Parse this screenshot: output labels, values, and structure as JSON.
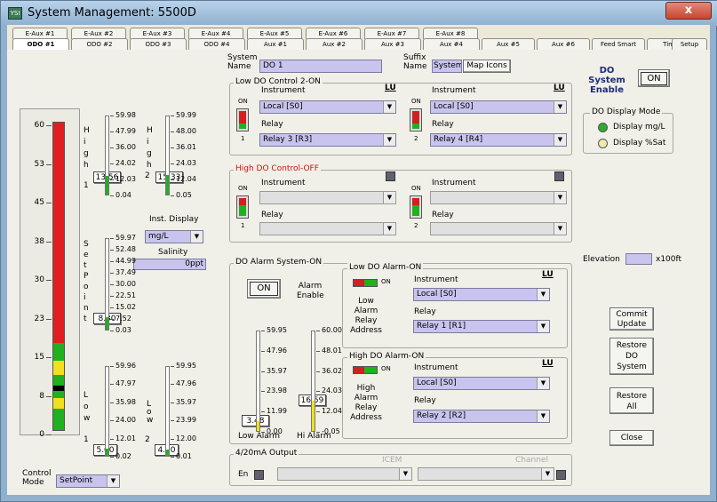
{
  "window": {
    "title": "System Management: 5500D",
    "icon": "app-icon",
    "close": "x"
  },
  "tabs_top": [
    "E-Aux #1",
    "E-Aux #2",
    "E-Aux #3",
    "E-Aux #4",
    "E-Aux #5",
    "E-Aux #6",
    "E-Aux #7",
    "E-Aux #8"
  ],
  "tabs_bottom": [
    "ODO #1",
    "ODO #2",
    "ODO #3",
    "ODO #4",
    "Aux #1",
    "Aux #2",
    "Aux #3",
    "Aux #4",
    "Aux #5",
    "Aux #6",
    "Feed Smart",
    "Timers",
    "Setup"
  ],
  "system_name": {
    "label": "System Name",
    "value": "DO 1"
  },
  "suffix_name": {
    "label": "Suffix Name",
    "value": "System",
    "button": "Map Icons"
  },
  "do_enable": {
    "label": "DO System Enable",
    "state": "ON"
  },
  "display_mode": {
    "title": "DO Display Mode",
    "options": [
      "Display mg/L",
      "Display %Sat"
    ],
    "selected": "Display mg/L"
  },
  "bar": {
    "ticks": [
      "60",
      "53",
      "45",
      "38",
      "30",
      "23",
      "15",
      "8",
      "0"
    ]
  },
  "high": {
    "letters": [
      "H",
      "i",
      "g",
      "h"
    ],
    "scale1": [
      "59.98",
      "47.99",
      "36.00",
      "24.02",
      "12.03",
      "0.04"
    ],
    "scale2": [
      "59.99",
      "48.00",
      "36.01",
      "24.03",
      "12.04",
      "0.05"
    ],
    "v1": "13.56",
    "v2": "15.33",
    "n1": "1",
    "n2": "2"
  },
  "setpoint": {
    "letters": [
      "S",
      "e",
      "t",
      "P",
      "o",
      "i",
      "n",
      "t"
    ],
    "scale": [
      "59.97",
      "52.48",
      "44.99",
      "37.49",
      "30.00",
      "22.51",
      "15.02",
      "7.52",
      "0.03"
    ],
    "v": "8.30"
  },
  "inst_display": {
    "label": "Inst. Display",
    "value": "mg/L"
  },
  "salinity": {
    "label": "Salinity",
    "value": "0",
    "unit": "ppt"
  },
  "low": {
    "letters": [
      "L",
      "o",
      "w"
    ],
    "scale1": [
      "59.96",
      "47.97",
      "35.98",
      "24.00",
      "12.01",
      "0.02"
    ],
    "scale2": [
      "59.95",
      "47.96",
      "35.97",
      "23.99",
      "12.00",
      "0.01"
    ],
    "v1": "5.00",
    "v2": "4.00",
    "n1": "1",
    "n2": "2"
  },
  "control_mode": {
    "label": "Control Mode",
    "value": "SetPoint"
  },
  "low_ctrl": {
    "title": "Low DO Control 2-ON",
    "lu": "LU",
    "instrument": "Instrument",
    "relay": "Relay",
    "on": "ON",
    "i1": "Local [S0]",
    "r1": "Relay 3 [R3]",
    "i2": "Local [S0]",
    "r2": "Relay 4 [R4]",
    "n1": "1",
    "n2": "2"
  },
  "high_ctrl": {
    "title": "High DO Control-OFF",
    "instrument": "Instrument",
    "relay": "Relay",
    "on": "ON",
    "n1": "1",
    "n2": "2"
  },
  "alarm": {
    "title": "DO Alarm System-ON",
    "state": "ON",
    "enable": "Alarm Enable",
    "low_scale": [
      "59.95",
      "47.96",
      "35.97",
      "23.98",
      "11.99",
      "0.00"
    ],
    "hi_scale": [
      "60.00",
      "48.01",
      "36.02",
      "24.03",
      "12.04",
      "-0.05"
    ],
    "low_v": "3.48",
    "hi_v": "16.59",
    "low_label": "Low Alarm",
    "hi_label": "Hi Alarm"
  },
  "low_alarm": {
    "title": "Low DO Alarm-ON",
    "on": "ON",
    "lu": "LU",
    "instrument": "Instrument",
    "relay": "Relay",
    "inst": "Local [S0]",
    "rel": "Relay 1 [R1]",
    "addr": "Low Alarm Relay Address"
  },
  "high_alarm": {
    "title": "High DO Alarm-ON",
    "on": "ON",
    "lu": "LU",
    "instrument": "Instrument",
    "relay": "Relay",
    "inst": "Local [S0]",
    "rel": "Relay 2 [R2]",
    "addr": "High Alarm Relay Address"
  },
  "output": {
    "title": "4/20mA Output",
    "en": "En",
    "icem": "ICEM",
    "channel": "Channel"
  },
  "elevation": {
    "label": "Elevation",
    "unit": "x100ft"
  },
  "buttons": {
    "commit": "Commit Update",
    "restore_do": "Restore DO System",
    "restore_all": "Restore All",
    "close": "Close"
  }
}
